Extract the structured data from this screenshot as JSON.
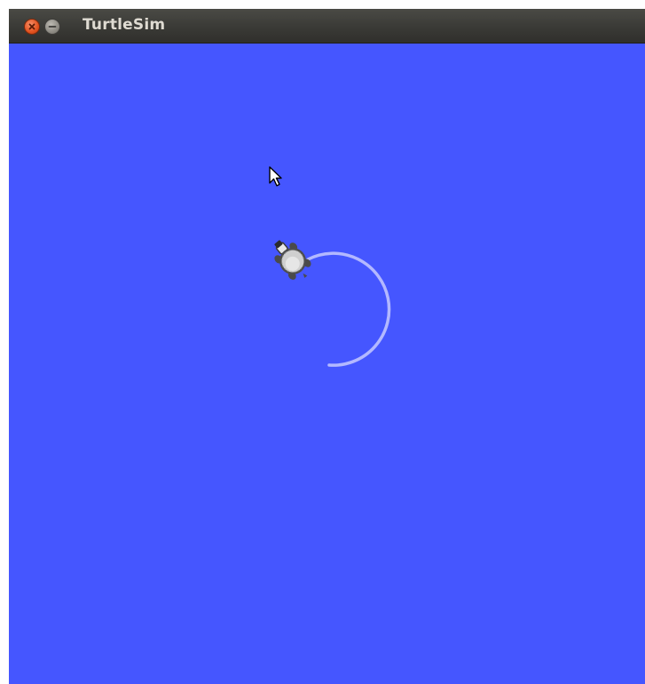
{
  "window": {
    "title": "TurtleSim",
    "controls": [
      "close-icon",
      "minimize-icon"
    ]
  },
  "canvas": {
    "background_color": "#4556ff",
    "pen_color": "#b3b8ff",
    "turtle_color": "#c8c8c8",
    "cursor_icon": "arrow-cursor-icon"
  }
}
